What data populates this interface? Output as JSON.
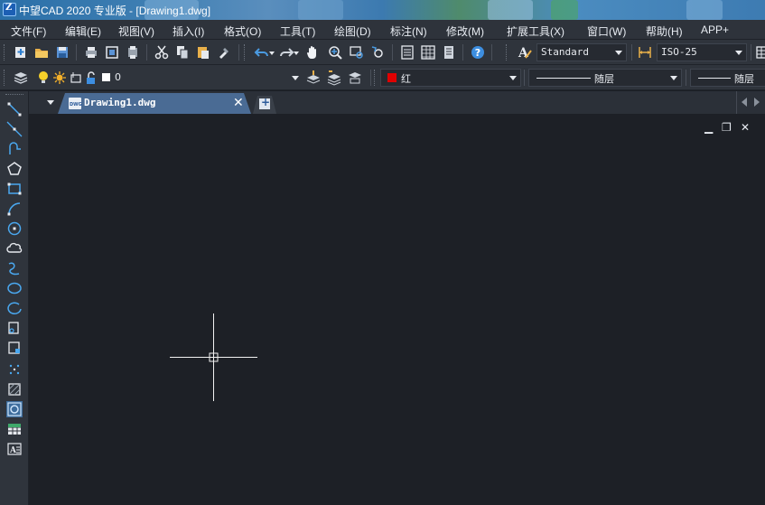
{
  "window": {
    "title": "中望CAD 2020 专业版 - [Drawing1.dwg]",
    "app_icon_letter": "Z"
  },
  "menu": {
    "items": [
      "文件(F)",
      "编辑(E)",
      "视图(V)",
      "插入(I)",
      "格式(O)",
      "工具(T)",
      "绘图(D)",
      "标注(N)",
      "修改(M)",
      "扩展工具(X)",
      "窗口(W)",
      "帮助(H)",
      "APP+"
    ]
  },
  "toolbar_standard": {
    "icons": [
      "new-file-icon",
      "open-folder-icon",
      "save-icon",
      "print-icon",
      "plot-preview-icon",
      "publish-icon",
      "cut-icon",
      "copy-icon",
      "paste-icon",
      "match-properties-icon",
      "undo-icon",
      "redo-icon",
      "pan-hand-icon",
      "zoom-realtime-icon",
      "zoom-window-icon",
      "zoom-previous-icon",
      "properties-icon",
      "design-center-icon",
      "tool-palette-icon",
      "help-icon"
    ],
    "text_style": "Standard",
    "dim_style": "ISO-25"
  },
  "toolbar_layers": {
    "current_layer": "0",
    "color": "红",
    "color_hex": "#e00000",
    "linetype": "随层",
    "lineweight": "随层"
  },
  "draw_toolbar": {
    "icons": [
      "line-icon",
      "construction-line-icon",
      "polyline-icon",
      "polygon-icon",
      "rectangle-icon",
      "arc-icon",
      "circle-icon",
      "revision-cloud-icon",
      "spline-icon",
      "ellipse-icon",
      "ellipse-arc-icon",
      "insert-block-icon",
      "make-block-icon",
      "point-icon",
      "hatch-icon",
      "region-icon",
      "table-icon",
      "multiline-text-icon"
    ]
  },
  "tabs": {
    "document": "Drawing1.dwg",
    "file_badge": "DWG",
    "close_glyph": "✕"
  },
  "canvas": {
    "background": "#1d2026",
    "min_glyph": "▁",
    "restore_glyph": "❐",
    "close_glyph": "✕"
  }
}
